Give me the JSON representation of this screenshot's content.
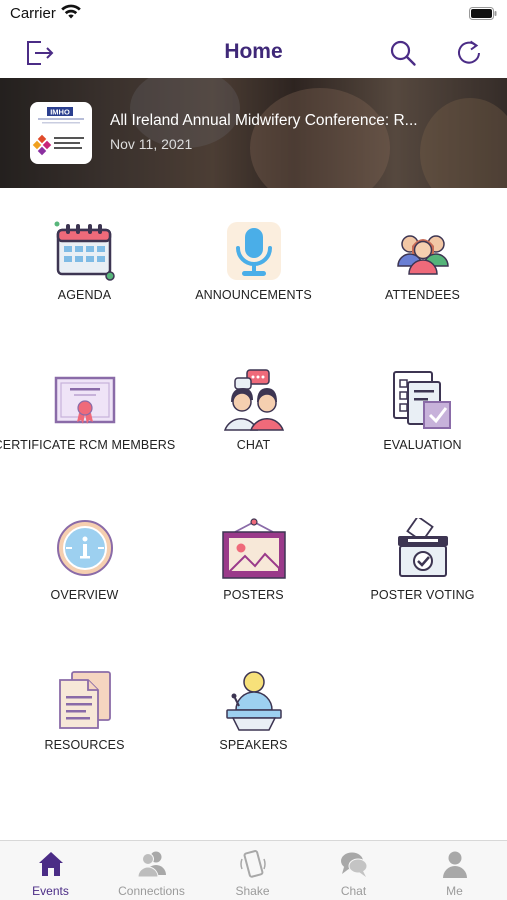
{
  "status_bar": {
    "carrier": "Carrier"
  },
  "nav": {
    "title": "Home"
  },
  "banner": {
    "title": "All Ireland  Annual  Midwifery Conference: R...",
    "date": "Nov 11, 2021",
    "logo_text_top": "IMHO",
    "logo_text_bottom": "Royal College of Midwives"
  },
  "grid": {
    "items": [
      {
        "label": "AGENDA"
      },
      {
        "label": "ANNOUNCEMENTS"
      },
      {
        "label": "ATTENDEES"
      },
      {
        "label": "CERTIFICATE RCM MEMBERS"
      },
      {
        "label": "CHAT"
      },
      {
        "label": "EVALUATION"
      },
      {
        "label": "OVERVIEW"
      },
      {
        "label": "POSTERS"
      },
      {
        "label": "POSTER VOTING"
      },
      {
        "label": "RESOURCES"
      },
      {
        "label": "SPEAKERS"
      }
    ]
  },
  "tabs": [
    {
      "label": "Events"
    },
    {
      "label": "Connections"
    },
    {
      "label": "Shake"
    },
    {
      "label": "Chat"
    },
    {
      "label": "Me"
    }
  ],
  "colors": {
    "accent": "#3f2878",
    "tab_active": "#4b2c86",
    "tab_inactive": "#9b9b9b"
  }
}
